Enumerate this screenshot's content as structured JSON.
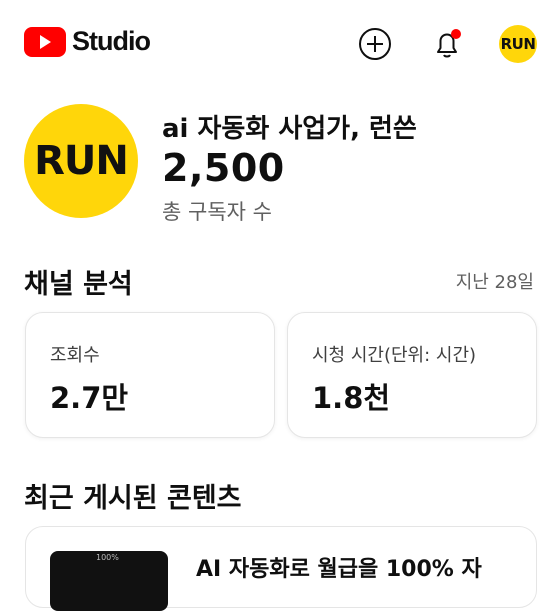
{
  "app": {
    "logo_text": "Studio"
  },
  "header": {
    "create_icon": "plus-circle-icon",
    "notification_icon": "bell-icon",
    "notification_dot_color": "#ff0000",
    "avatar_text": "RUN"
  },
  "channel": {
    "avatar_text": "RUN",
    "name": "ai 자동화 사업가, 런쓴",
    "subscriber_count": "2,500",
    "subscriber_label": "총 구독자 수"
  },
  "analytics": {
    "title": "채널 분석",
    "period": "지난 28일",
    "cards": [
      {
        "label": "조회수",
        "value": "2.7만"
      },
      {
        "label": "시청 시간(단위: 시간)",
        "value": "1.8천"
      }
    ]
  },
  "recent": {
    "title": "최근 게시된 콘텐츠",
    "thumb_text": "100%",
    "video_title": "AI 자동화로 월급을 100% 자"
  },
  "colors": {
    "brand": "#ff0000",
    "avatar_bg": "#ffd60a",
    "secondary_text": "#606060"
  }
}
